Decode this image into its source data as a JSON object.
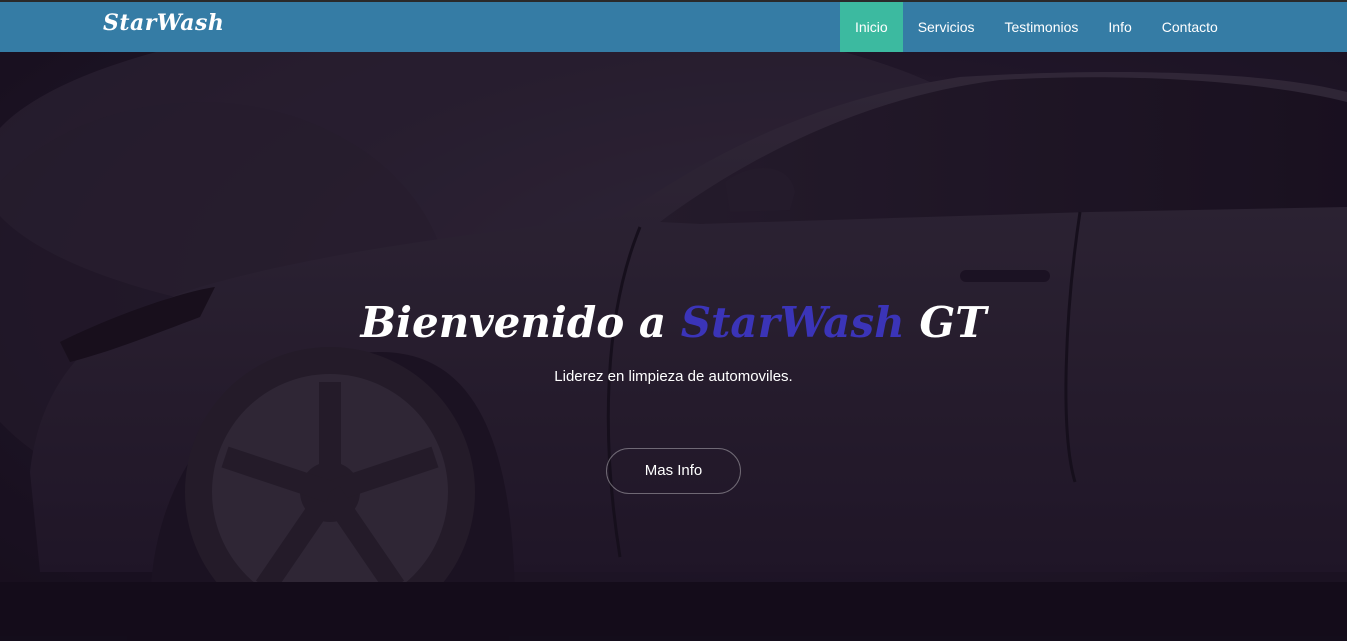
{
  "navbar": {
    "brand": "StarWash",
    "items": [
      {
        "label": "Inicio",
        "active": true
      },
      {
        "label": "Servicios",
        "active": false
      },
      {
        "label": "Testimonios",
        "active": false
      },
      {
        "label": "Info",
        "active": false
      },
      {
        "label": "Contacto",
        "active": false
      }
    ]
  },
  "hero": {
    "title_prefix": "Bienvenido a ",
    "title_brand": "StarWash",
    "title_suffix": " GT",
    "subtitle": "Liderez en limpieza de automoviles.",
    "button_label": "Mas Info",
    "background_image": "car-wash-photo"
  },
  "colors": {
    "navbar": "#357ca5",
    "active_nav": "#3cbaa0",
    "brand_accent": "#3b34b8",
    "hero_dark": "#1a1220"
  }
}
